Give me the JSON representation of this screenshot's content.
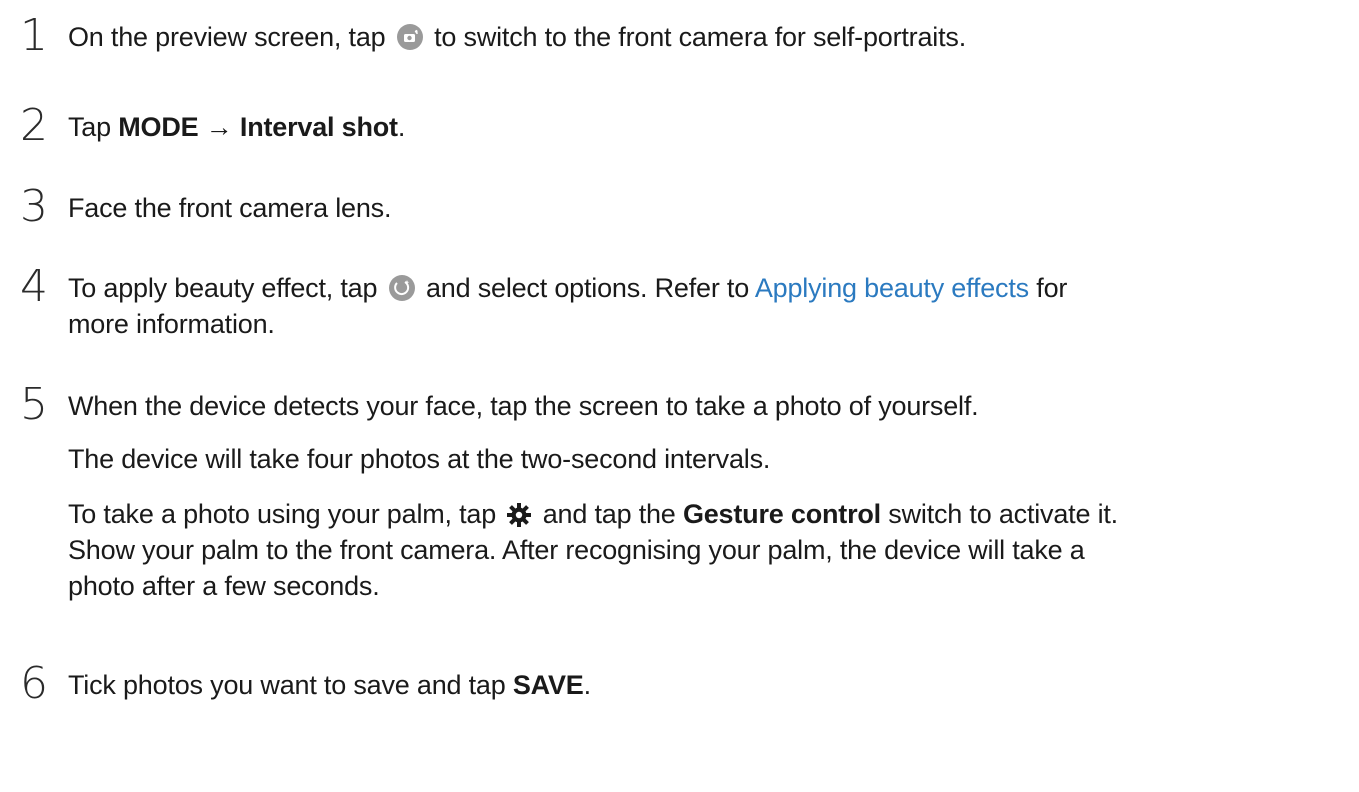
{
  "steps": [
    {
      "number": "1",
      "lines": [
        {
          "a": "On the preview screen, tap",
          "b": "to switch to the front camera for self-portraits."
        }
      ],
      "icon": "camera-switch-icon"
    },
    {
      "number": "2",
      "tap": "Tap",
      "mode": "MODE",
      "arrow": "→",
      "interval": "Interval shot",
      "period": "."
    },
    {
      "number": "3",
      "text": "Face the front camera lens."
    },
    {
      "number": "4",
      "a": "To apply beauty effect, tap",
      "b": "and select options. Refer to",
      "link": "Applying beauty effects",
      "c": "for",
      "line2": "more information.",
      "icon": "beauty-face-icon"
    },
    {
      "number": "5",
      "line1": "When the device detects your face, tap the screen to take a photo of yourself.",
      "line2": "The device will take four photos at the two-second intervals.",
      "line3a": "To take a photo using your palm, tap",
      "line3b": "and tap the",
      "gesture": "Gesture control",
      "line3c": "switch to activate it.",
      "line4": "Show your palm to the front camera. After recognising your palm, the device will take a",
      "line5": "photo after a few seconds.",
      "icon": "settings-gear-icon"
    },
    {
      "number": "6",
      "a": "Tick photos you want to save and tap",
      "save": "SAVE",
      "period": "."
    }
  ],
  "colors": {
    "text": "#1a1a1a",
    "link": "#2b7ac0",
    "icon_bg": "#9a9a9a"
  }
}
